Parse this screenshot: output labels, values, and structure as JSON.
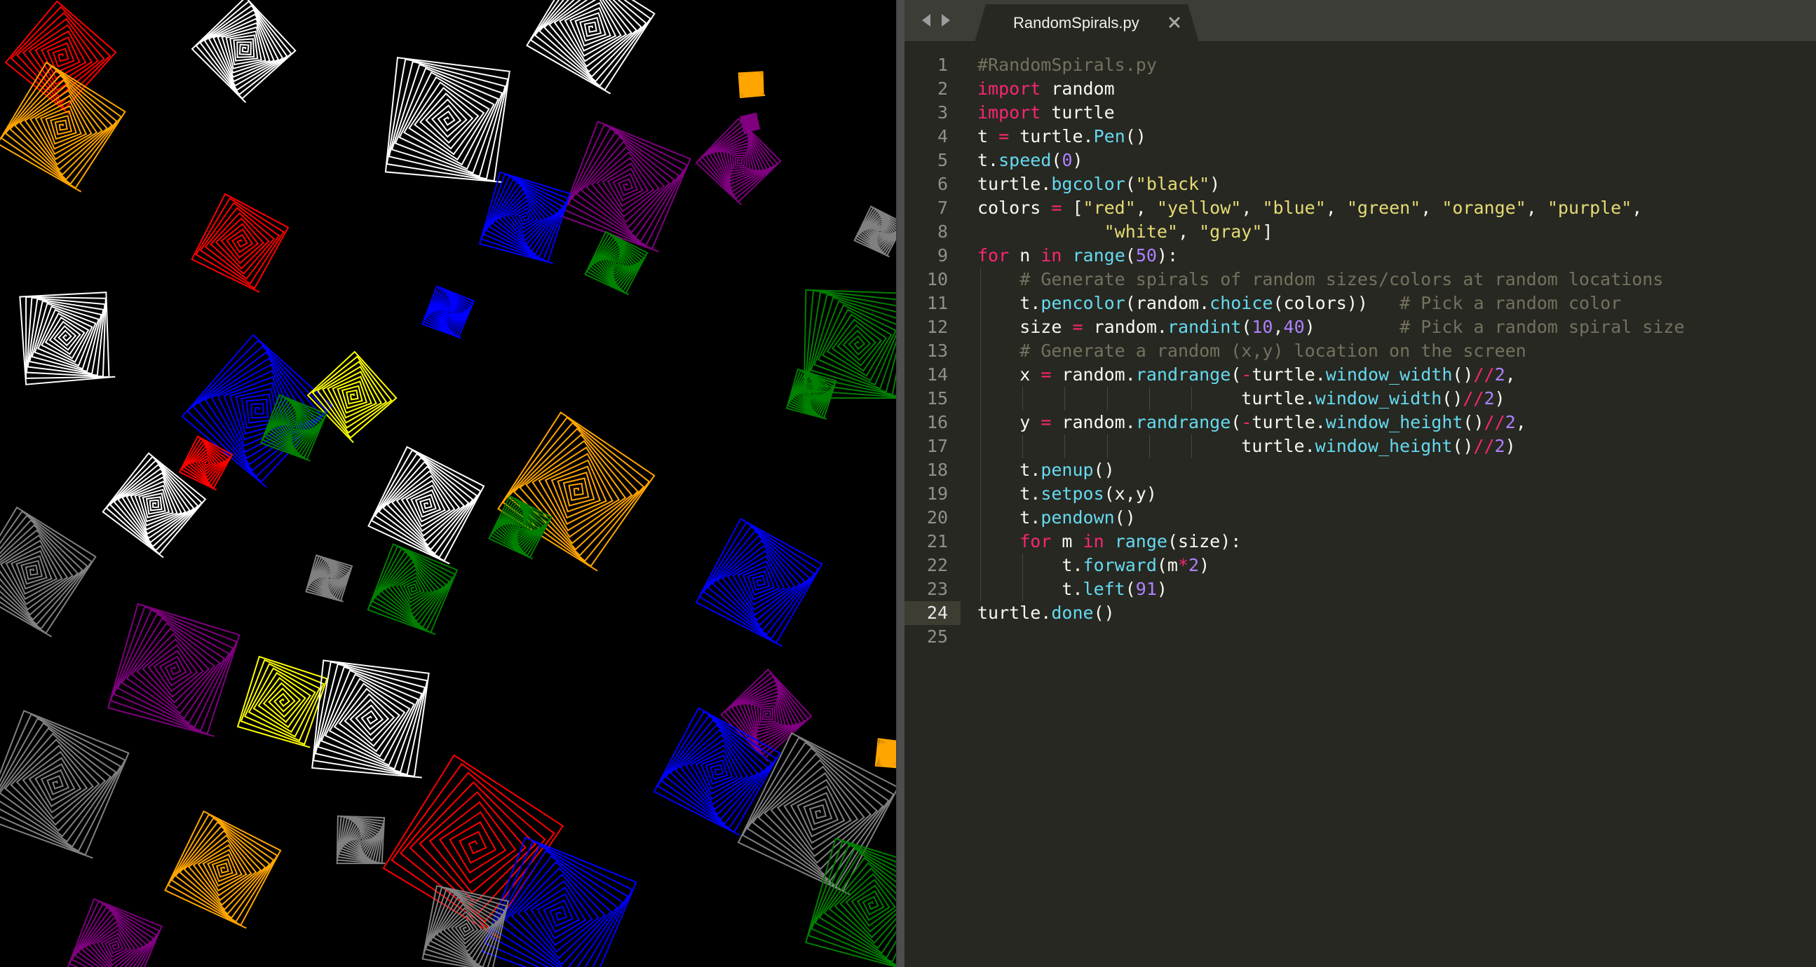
{
  "turtle_window": {
    "background": "#000000"
  },
  "spirals": [
    {
      "color": "#ff0000",
      "turns": 10
    },
    {
      "color": "#ffff00",
      "turns": 10
    },
    {
      "color": "#0000ff",
      "turns": 14
    },
    {
      "color": "#008000",
      "turns": 14
    },
    {
      "color": "#ffa500",
      "turns": 14
    },
    {
      "color": "#800080",
      "turns": 14
    },
    {
      "color": "#ffffff",
      "turns": 14
    },
    {
      "color": "#808080",
      "turns": 14
    }
  ],
  "editor": {
    "nav": {
      "back_icon": "chevron-left-icon",
      "forward_icon": "chevron-right-icon"
    },
    "tab": {
      "title": "RandomSpirals.py",
      "close_icon": "close-icon"
    },
    "current_line": 24,
    "colors": {
      "keyword": "#f92672",
      "function": "#66d9ef",
      "string": "#e6db74",
      "number": "#ae81ff",
      "comment": "#75715e",
      "plain": "#f8f8f2"
    },
    "lines": [
      {
        "no": "1",
        "indent": 0,
        "tokens": [
          {
            "t": "cm",
            "v": "#RandomSpirals.py"
          }
        ]
      },
      {
        "no": "2",
        "indent": 0,
        "tokens": [
          {
            "t": "kw",
            "v": "import"
          },
          {
            "t": "pl",
            "v": " random"
          }
        ]
      },
      {
        "no": "3",
        "indent": 0,
        "tokens": [
          {
            "t": "kw",
            "v": "import"
          },
          {
            "t": "pl",
            "v": " turtle"
          }
        ]
      },
      {
        "no": "4",
        "indent": 0,
        "tokens": [
          {
            "t": "pl",
            "v": "t "
          },
          {
            "t": "kw",
            "v": "="
          },
          {
            "t": "pl",
            "v": " turtle."
          },
          {
            "t": "fn",
            "v": "Pen"
          },
          {
            "t": "pl",
            "v": "()"
          }
        ]
      },
      {
        "no": "5",
        "indent": 0,
        "tokens": [
          {
            "t": "pl",
            "v": "t."
          },
          {
            "t": "fn",
            "v": "speed"
          },
          {
            "t": "pl",
            "v": "("
          },
          {
            "t": "num",
            "v": "0"
          },
          {
            "t": "pl",
            "v": ")"
          }
        ]
      },
      {
        "no": "6",
        "indent": 0,
        "tokens": [
          {
            "t": "pl",
            "v": "turtle."
          },
          {
            "t": "fn",
            "v": "bgcolor"
          },
          {
            "t": "pl",
            "v": "("
          },
          {
            "t": "str",
            "v": "\"black\""
          },
          {
            "t": "pl",
            "v": ")"
          }
        ]
      },
      {
        "no": "7",
        "indent": 0,
        "tokens": [
          {
            "t": "pl",
            "v": "colors "
          },
          {
            "t": "kw",
            "v": "="
          },
          {
            "t": "pl",
            "v": " ["
          },
          {
            "t": "str",
            "v": "\"red\""
          },
          {
            "t": "pl",
            "v": ", "
          },
          {
            "t": "str",
            "v": "\"yellow\""
          },
          {
            "t": "pl",
            "v": ", "
          },
          {
            "t": "str",
            "v": "\"blue\""
          },
          {
            "t": "pl",
            "v": ", "
          },
          {
            "t": "str",
            "v": "\"green\""
          },
          {
            "t": "pl",
            "v": ", "
          },
          {
            "t": "str",
            "v": "\"orange\""
          },
          {
            "t": "pl",
            "v": ", "
          },
          {
            "t": "str",
            "v": "\"purple\""
          },
          {
            "t": "pl",
            "v": ","
          }
        ]
      },
      {
        "no": "8",
        "indent": 0,
        "tokens": [
          {
            "t": "pl",
            "v": "            "
          },
          {
            "t": "str",
            "v": "\"white\""
          },
          {
            "t": "pl",
            "v": ", "
          },
          {
            "t": "str",
            "v": "\"gray\""
          },
          {
            "t": "pl",
            "v": "]"
          }
        ]
      },
      {
        "no": "9",
        "indent": 0,
        "tokens": [
          {
            "t": "kw",
            "v": "for"
          },
          {
            "t": "pl",
            "v": " n "
          },
          {
            "t": "kw",
            "v": "in"
          },
          {
            "t": "pl",
            "v": " "
          },
          {
            "t": "fn",
            "v": "range"
          },
          {
            "t": "pl",
            "v": "("
          },
          {
            "t": "num",
            "v": "50"
          },
          {
            "t": "pl",
            "v": "):"
          }
        ]
      },
      {
        "no": "10",
        "indent": 1,
        "tokens": [
          {
            "t": "pl",
            "v": "    "
          },
          {
            "t": "cm",
            "v": "# Generate spirals of random sizes/colors at random locations"
          }
        ]
      },
      {
        "no": "11",
        "indent": 1,
        "tokens": [
          {
            "t": "pl",
            "v": "    t."
          },
          {
            "t": "fn",
            "v": "pencolor"
          },
          {
            "t": "pl",
            "v": "(random."
          },
          {
            "t": "fn",
            "v": "choice"
          },
          {
            "t": "pl",
            "v": "(colors))   "
          },
          {
            "t": "cm",
            "v": "# Pick a random color"
          }
        ]
      },
      {
        "no": "12",
        "indent": 1,
        "tokens": [
          {
            "t": "pl",
            "v": "    size "
          },
          {
            "t": "kw",
            "v": "="
          },
          {
            "t": "pl",
            "v": " random."
          },
          {
            "t": "fn",
            "v": "randint"
          },
          {
            "t": "pl",
            "v": "("
          },
          {
            "t": "num",
            "v": "10"
          },
          {
            "t": "pl",
            "v": ","
          },
          {
            "t": "num",
            "v": "40"
          },
          {
            "t": "pl",
            "v": ")        "
          },
          {
            "t": "cm",
            "v": "# Pick a random spiral size"
          }
        ]
      },
      {
        "no": "13",
        "indent": 1,
        "tokens": [
          {
            "t": "pl",
            "v": "    "
          },
          {
            "t": "cm",
            "v": "# Generate a random (x,y) location on the screen"
          }
        ]
      },
      {
        "no": "14",
        "indent": 1,
        "tokens": [
          {
            "t": "pl",
            "v": "    x "
          },
          {
            "t": "kw",
            "v": "="
          },
          {
            "t": "pl",
            "v": " random."
          },
          {
            "t": "fn",
            "v": "randrange"
          },
          {
            "t": "pl",
            "v": "("
          },
          {
            "t": "kw",
            "v": "-"
          },
          {
            "t": "pl",
            "v": "turtle."
          },
          {
            "t": "fn",
            "v": "window_width"
          },
          {
            "t": "pl",
            "v": "()"
          },
          {
            "t": "kw",
            "v": "//"
          },
          {
            "t": "num",
            "v": "2"
          },
          {
            "t": "pl",
            "v": ","
          }
        ]
      },
      {
        "no": "15",
        "indent": 6,
        "tokens": [
          {
            "t": "pl",
            "v": "                         turtle."
          },
          {
            "t": "fn",
            "v": "window_width"
          },
          {
            "t": "pl",
            "v": "()"
          },
          {
            "t": "kw",
            "v": "//"
          },
          {
            "t": "num",
            "v": "2"
          },
          {
            "t": "pl",
            "v": ")"
          }
        ]
      },
      {
        "no": "16",
        "indent": 1,
        "tokens": [
          {
            "t": "pl",
            "v": "    y "
          },
          {
            "t": "kw",
            "v": "="
          },
          {
            "t": "pl",
            "v": " random."
          },
          {
            "t": "fn",
            "v": "randrange"
          },
          {
            "t": "pl",
            "v": "("
          },
          {
            "t": "kw",
            "v": "-"
          },
          {
            "t": "pl",
            "v": "turtle."
          },
          {
            "t": "fn",
            "v": "window_height"
          },
          {
            "t": "pl",
            "v": "()"
          },
          {
            "t": "kw",
            "v": "//"
          },
          {
            "t": "num",
            "v": "2"
          },
          {
            "t": "pl",
            "v": ","
          }
        ]
      },
      {
        "no": "17",
        "indent": 6,
        "tokens": [
          {
            "t": "pl",
            "v": "                         turtle."
          },
          {
            "t": "fn",
            "v": "window_height"
          },
          {
            "t": "pl",
            "v": "()"
          },
          {
            "t": "kw",
            "v": "//"
          },
          {
            "t": "num",
            "v": "2"
          },
          {
            "t": "pl",
            "v": ")"
          }
        ]
      },
      {
        "no": "18",
        "indent": 1,
        "tokens": [
          {
            "t": "pl",
            "v": "    t."
          },
          {
            "t": "fn",
            "v": "penup"
          },
          {
            "t": "pl",
            "v": "()"
          }
        ]
      },
      {
        "no": "19",
        "indent": 1,
        "tokens": [
          {
            "t": "pl",
            "v": "    t."
          },
          {
            "t": "fn",
            "v": "setpos"
          },
          {
            "t": "pl",
            "v": "(x,y)"
          }
        ]
      },
      {
        "no": "20",
        "indent": 1,
        "tokens": [
          {
            "t": "pl",
            "v": "    t."
          },
          {
            "t": "fn",
            "v": "pendown"
          },
          {
            "t": "pl",
            "v": "()"
          }
        ]
      },
      {
        "no": "21",
        "indent": 1,
        "tokens": [
          {
            "t": "pl",
            "v": "    "
          },
          {
            "t": "kw",
            "v": "for"
          },
          {
            "t": "pl",
            "v": " m "
          },
          {
            "t": "kw",
            "v": "in"
          },
          {
            "t": "pl",
            "v": " "
          },
          {
            "t": "fn",
            "v": "range"
          },
          {
            "t": "pl",
            "v": "(size):"
          }
        ]
      },
      {
        "no": "22",
        "indent": 2,
        "tokens": [
          {
            "t": "pl",
            "v": "        t."
          },
          {
            "t": "fn",
            "v": "forward"
          },
          {
            "t": "pl",
            "v": "(m"
          },
          {
            "t": "kw",
            "v": "*"
          },
          {
            "t": "num",
            "v": "2"
          },
          {
            "t": "pl",
            "v": ")"
          }
        ]
      },
      {
        "no": "23",
        "indent": 2,
        "tokens": [
          {
            "t": "pl",
            "v": "        t."
          },
          {
            "t": "fn",
            "v": "left"
          },
          {
            "t": "pl",
            "v": "("
          },
          {
            "t": "num",
            "v": "91"
          },
          {
            "t": "pl",
            "v": ")"
          }
        ]
      },
      {
        "no": "24",
        "indent": 0,
        "tokens": [
          {
            "t": "pl",
            "v": "turtle."
          },
          {
            "t": "fn",
            "v": "done"
          },
          {
            "t": "pl",
            "v": "()"
          }
        ]
      },
      {
        "no": "25",
        "indent": 0,
        "tokens": []
      }
    ]
  }
}
